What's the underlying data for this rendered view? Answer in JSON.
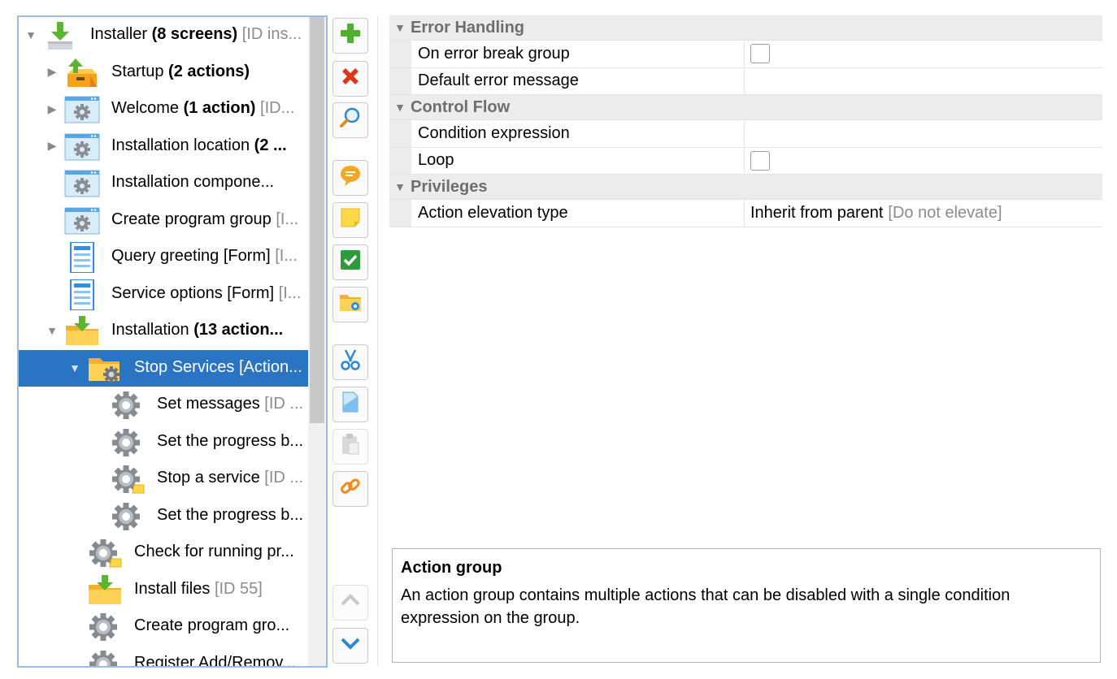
{
  "tree": {
    "items": [
      {
        "depth": 0,
        "expander": "expanded",
        "icon": "installer-icon",
        "name": "Installer",
        "bold": "(8 screens)",
        "suffix": "[ID ins..."
      },
      {
        "depth": 1,
        "expander": "collapsed",
        "icon": "startup-icon",
        "name": "Startup",
        "bold": "(2 actions)",
        "suffix": ""
      },
      {
        "depth": 1,
        "expander": "collapsed",
        "icon": "screen-icon",
        "name": "Welcome",
        "bold": "(1 action)",
        "suffix": "[ID..."
      },
      {
        "depth": 1,
        "expander": "collapsed",
        "icon": "screen-icon",
        "name": "Installation location",
        "bold": "(2 ...",
        "suffix": ""
      },
      {
        "depth": 1,
        "expander": "none",
        "icon": "screen-icon",
        "name": "Installation compone...",
        "bold": "",
        "suffix": ""
      },
      {
        "depth": 1,
        "expander": "none",
        "icon": "screen-icon",
        "name": "Create program group",
        "bold": "",
        "suffix": "[I..."
      },
      {
        "depth": 1,
        "expander": "none",
        "icon": "form-icon",
        "name": "Query greeting [Form]",
        "bold": "",
        "suffix": "[I..."
      },
      {
        "depth": 1,
        "expander": "none",
        "icon": "form-icon",
        "name": "Service options [Form]",
        "bold": "",
        "suffix": "[I..."
      },
      {
        "depth": 1,
        "expander": "expanded",
        "icon": "installation-folder-icon",
        "name": "Installation",
        "bold": "(13 action...",
        "suffix": ""
      },
      {
        "depth": 2,
        "expander": "expanded",
        "icon": "action-group-icon",
        "name": "Stop Services [Action...",
        "bold": "",
        "suffix": "",
        "selected": true
      },
      {
        "depth": 3,
        "expander": "none",
        "icon": "gear-icon",
        "name": "Set messages",
        "bold": "",
        "suffix": "[ID ..."
      },
      {
        "depth": 3,
        "expander": "none",
        "icon": "gear-icon",
        "name": "Set the progress b...",
        "bold": "",
        "suffix": ""
      },
      {
        "depth": 3,
        "expander": "none",
        "icon": "gear-script-icon",
        "name": "Stop a service",
        "bold": "",
        "suffix": "[ID ..."
      },
      {
        "depth": 3,
        "expander": "none",
        "icon": "gear-icon",
        "name": "Set the progress b...",
        "bold": "",
        "suffix": ""
      },
      {
        "depth": 2,
        "expander": "none",
        "icon": "gear-script-icon",
        "name": "Check for running pr...",
        "bold": "",
        "suffix": ""
      },
      {
        "depth": 2,
        "expander": "none",
        "icon": "install-files-icon",
        "name": "Install files",
        "bold": "",
        "suffix": "[ID 55]"
      },
      {
        "depth": 2,
        "expander": "none",
        "icon": "gear-icon",
        "name": "Create program gro...",
        "bold": "",
        "suffix": ""
      },
      {
        "depth": 2,
        "expander": "none",
        "icon": "gear-icon",
        "name": "Register Add/Remov...",
        "bold": "",
        "suffix": ""
      }
    ]
  },
  "toolbar": {
    "buttons": [
      {
        "name": "add-button",
        "icon": "plus-icon",
        "enabled": true
      },
      {
        "name": "delete-button",
        "icon": "delete-x-icon",
        "enabled": true
      },
      {
        "name": "search-button",
        "icon": "magnifier-icon",
        "enabled": true
      },
      {
        "name": "comment-button",
        "icon": "comment-icon",
        "enabled": true
      },
      {
        "name": "note-button",
        "icon": "sticky-note-icon",
        "enabled": true
      },
      {
        "name": "check-button",
        "icon": "checkmark-icon",
        "enabled": true
      },
      {
        "name": "folder-button",
        "icon": "folder-gear-icon",
        "enabled": true
      },
      {
        "name": "cut-button",
        "icon": "scissors-icon",
        "enabled": true
      },
      {
        "name": "copy-button",
        "icon": "copy-icon",
        "enabled": true
      },
      {
        "name": "paste-button",
        "icon": "paste-icon",
        "enabled": false
      },
      {
        "name": "link-button",
        "icon": "link-icon",
        "enabled": true
      },
      {
        "name": "move-up-button",
        "icon": "chevron-up-icon",
        "enabled": false
      },
      {
        "name": "move-down-button",
        "icon": "chevron-down-icon",
        "enabled": true
      }
    ]
  },
  "properties": {
    "categories": [
      {
        "label": "Error Handling",
        "rows": [
          {
            "name": "On error break group",
            "type": "checkbox",
            "checked": false,
            "value": "",
            "hint": ""
          },
          {
            "name": "Default error message",
            "type": "text",
            "value": "",
            "hint": ""
          }
        ]
      },
      {
        "label": "Control Flow",
        "rows": [
          {
            "name": "Condition expression",
            "type": "text",
            "value": "",
            "hint": ""
          },
          {
            "name": "Loop",
            "type": "checkbox",
            "checked": false,
            "value": "",
            "hint": ""
          }
        ]
      },
      {
        "label": "Privileges",
        "rows": [
          {
            "name": "Action elevation type",
            "type": "text",
            "value": "Inherit from parent",
            "hint": "[Do not elevate]"
          }
        ]
      }
    ]
  },
  "description": {
    "title": "Action group",
    "text": "An action group contains multiple actions that can be disabled with a single condition expression on the group."
  }
}
